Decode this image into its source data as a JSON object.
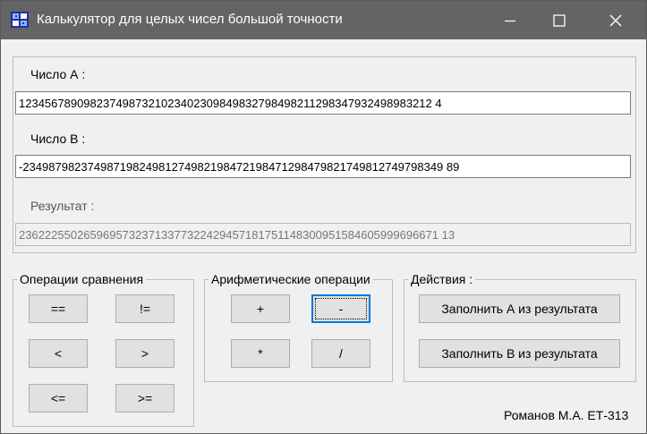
{
  "window": {
    "title": "Калькулятор для целых чисел большой точности",
    "controls": {
      "minimize": "minimize",
      "maximize": "maximize",
      "close": "close"
    }
  },
  "inputs": {
    "a": {
      "label": "Число А :",
      "value": "1234567890982374987321023402309849832798498211298347932498983212 4"
    },
    "b": {
      "label": "Число В :",
      "value": "-23498798237498719824981274982198472198471298479821749812749798349 89"
    },
    "result": {
      "label": "Результат :",
      "value": "23622255026596957323713377322429457181751148300951584605999696671 13"
    }
  },
  "groups": {
    "comparison": {
      "title": "Операции сравнения",
      "buttons": [
        "==",
        "!=",
        "<",
        ">",
        "<=",
        ">="
      ]
    },
    "arithmetic": {
      "title": "Арифметические операции",
      "buttons": [
        "+",
        "-",
        "*",
        "/"
      ]
    },
    "actions": {
      "title": "Действия :",
      "buttons": [
        "Заполнить А из результата",
        "Заполнить В из результата"
      ]
    }
  },
  "footer": {
    "author": "Романов М.А. ЕТ-313"
  },
  "colors": {
    "titlebar": "#646464",
    "window_bg": "#f0f0f0",
    "focus": "#0078d7"
  }
}
